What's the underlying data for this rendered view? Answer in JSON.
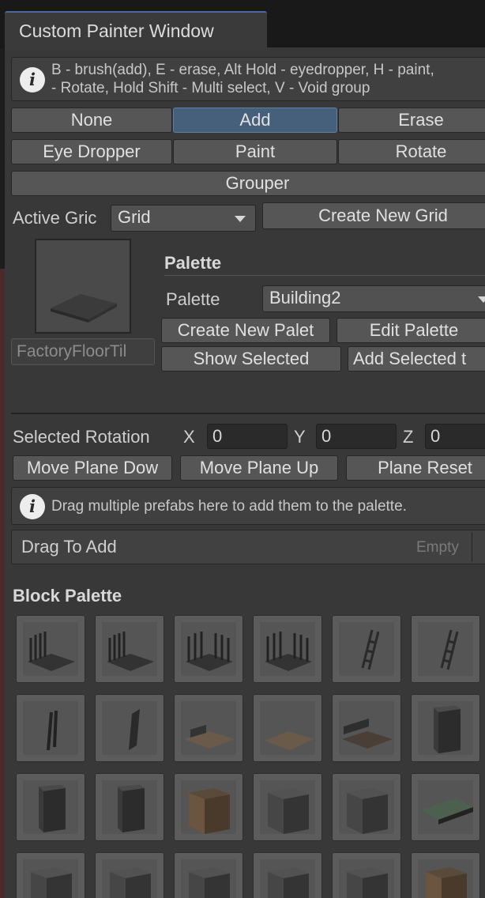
{
  "window": {
    "tab_title": "Custom Painter Window"
  },
  "shortcuts_help": {
    "line1": "B - brush(add), E - erase, Alt Hold - eyedropper, H - paint,",
    "line2": "- Rotate, Hold Shift - Multi select, V - Void group"
  },
  "modes": {
    "row1": [
      "None",
      "Add",
      "Erase"
    ],
    "row2": [
      "Eye Dropper",
      "Paint",
      "Rotate"
    ],
    "row3": [
      "Grouper"
    ],
    "active": "Add"
  },
  "grid": {
    "label": "Active Gric",
    "selected": "Grid",
    "create_button": "Create New Grid"
  },
  "preview": {
    "name": "FactoryFloorTil"
  },
  "palette": {
    "header": "Palette",
    "label": "Palette",
    "selected": "Building2",
    "create_button": "Create New Palet",
    "edit_button": "Edit Palette",
    "show_selected_button": "Show Selected",
    "add_selected_button": "Add Selected t"
  },
  "rotation": {
    "label": "Selected Rotation",
    "x_label": "X",
    "x_value": "0",
    "y_label": "Y",
    "y_value": "0",
    "z_label": "Z",
    "z_value": "0"
  },
  "plane": {
    "down_button": "Move Plane Dow",
    "up_button": "Move Plane Up",
    "reset_button": "Plane Reset"
  },
  "drag_help": {
    "text": "Drag multiple prefabs here to add them to the palette."
  },
  "drag_area": {
    "label": "Drag To Add",
    "status": "Empty"
  },
  "block_palette": {
    "header": "Block Palette",
    "items": [
      "railing-floor-icon",
      "railing-floor-icon",
      "railing-corner-icon",
      "railing-corner-icon",
      "ladder-icon",
      "ladder-icon",
      "pillar-thin-icon",
      "wall-panel-icon",
      "stair-floor-icon",
      "floor-tile-icon",
      "corner-bench-icon",
      "box-tall-icon",
      "box-tall-icon",
      "box-tall-icon",
      "box-brick-icon",
      "box-cube-icon",
      "box-cube-icon",
      "conveyor-icon",
      "box-cube-icon",
      "box-cube-icon",
      "box-cube-icon",
      "box-cube-icon",
      "box-cube-icon",
      "box-brick-icon"
    ]
  },
  "colors": {
    "accent": "#46607c",
    "panel": "#383838",
    "button": "#565656"
  }
}
